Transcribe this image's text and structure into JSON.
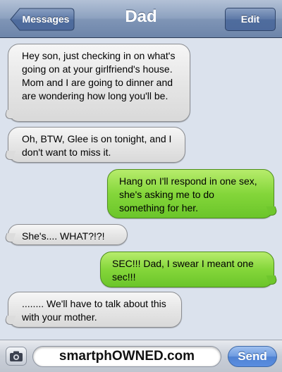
{
  "navbar": {
    "title": "Dad",
    "back_label": "Messages",
    "edit_label": "Edit",
    "back_icon": "chevron-left-icon"
  },
  "messages": [
    {
      "direction": "incoming",
      "text": "Hey son, just checking in on what's going on at your girlfriend's house. Mom and I are going to dinner and are wondering how long you'll be."
    },
    {
      "direction": "incoming",
      "text": "Oh, BTW, Glee is on tonight, and I don't want to miss it."
    },
    {
      "direction": "outgoing",
      "text": "Hang on I'll respond in one sex, she's asking me to do something for her."
    },
    {
      "direction": "incoming",
      "text": "She's.... WHAT?!?!"
    },
    {
      "direction": "outgoing",
      "text": "SEC!!! Dad, I swear I meant one sec!!!"
    },
    {
      "direction": "incoming",
      "text": "........ We'll have to talk about this with your mother."
    }
  ],
  "input": {
    "value": "smartphOWNED.com",
    "camera_icon": "camera-icon",
    "send_label": "Send"
  },
  "colors": {
    "incoming_bubble": "#e6e6e6",
    "outgoing_bubble": "#84d63a",
    "navbar": "#8da2c0",
    "background": "#dbe2ed",
    "send_button": "#5a8de0"
  }
}
